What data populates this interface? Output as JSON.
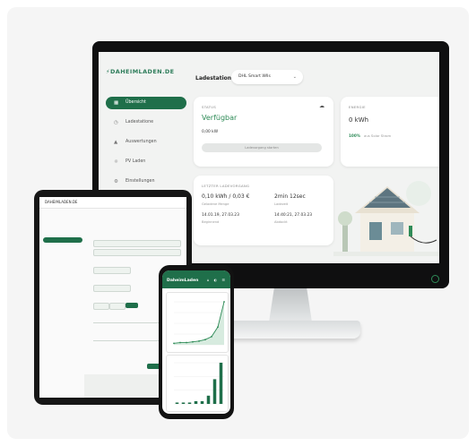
{
  "brand": {
    "logo": "DAHEIMLADEN.DE",
    "accent": "#1f6f4a",
    "green": "#2e8b57"
  },
  "dashboard": {
    "topbar_label": "Ladestation",
    "station_select": "DHL Smart Wlls",
    "nav": [
      {
        "label": "Übersicht",
        "icon": "grid-icon",
        "active": true
      },
      {
        "label": "Ladestatione",
        "icon": "clock-icon",
        "active": false
      },
      {
        "label": "Auswertungen",
        "icon": "chart-icon",
        "active": false
      },
      {
        "label": "PV Laden",
        "icon": "sun-icon",
        "active": false
      },
      {
        "label": "Einstellungen",
        "icon": "gear-icon",
        "active": false
      }
    ],
    "status": {
      "title": "STATUS",
      "value": "Verfügbar",
      "power": "0,00 kW",
      "button": "Ladevorgang starten"
    },
    "energy": {
      "title": "ENERGIE",
      "value": "0 kWh",
      "percent": "100%",
      "subtext": "aus Solar Strom"
    },
    "last": {
      "title": "LETZTER LADEVORGANG",
      "energy": "0,10 kWh / 0,03 €",
      "energy_sub": "Geladene Menge",
      "duration": "2min 12sec",
      "duration_sub": "Ladezeit",
      "start": "14.01.19, 27.03.23",
      "start_sub": "Beginnend",
      "end": "14:40:21, 27.03.23",
      "end_sub": "Abdockt"
    }
  },
  "tablet": {
    "title": "DAHEIMLADEN.DE"
  },
  "phone": {
    "title": "DaheimLaden",
    "icons": "⌂ ◐ ☰",
    "line_values": [
      2,
      3,
      3,
      4,
      5,
      7,
      11,
      24,
      58
    ],
    "bar_values": [
      1,
      1,
      1,
      2,
      2,
      6,
      18,
      30
    ]
  }
}
